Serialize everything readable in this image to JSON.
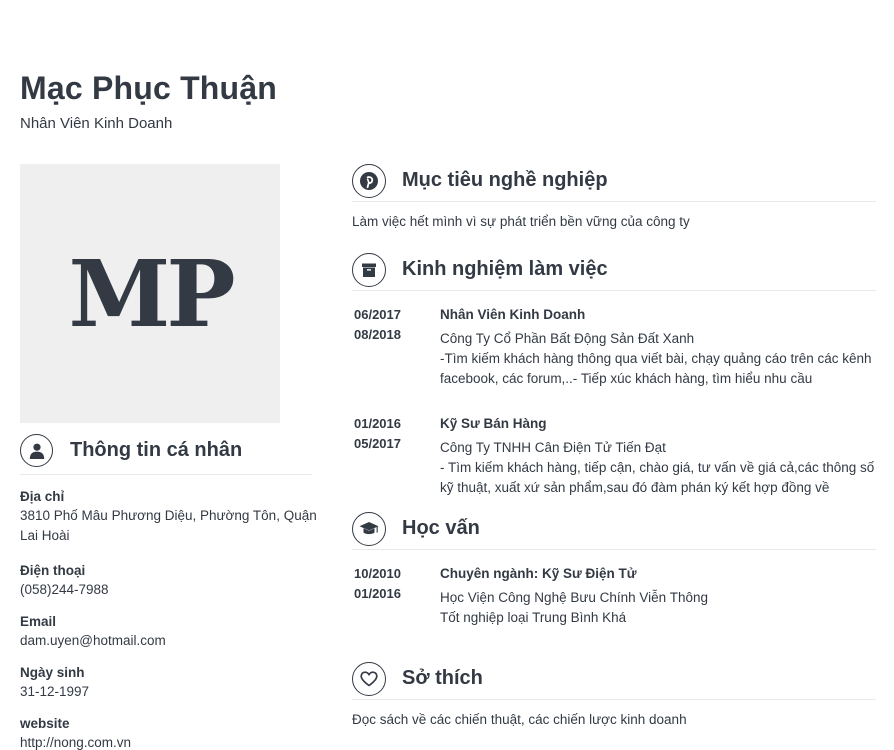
{
  "profile": {
    "name": "Mạc Phục Thuận",
    "title": "Nhân Viên Kinh Doanh",
    "initials": "MP"
  },
  "personal": {
    "heading": "Thông tin cá nhân",
    "items": [
      {
        "label": "Địa chỉ",
        "value": "3810 Phố Mâu Phương Diệu, Phường Tôn, Quận Lai Hoài"
      },
      {
        "label": "Điện thoại",
        "value": "(058)244-7988"
      },
      {
        "label": "Email",
        "value": "dam.uyen@hotmail.com"
      },
      {
        "label": "Ngày sinh",
        "value": "31-12-1997"
      },
      {
        "label": "website",
        "value": "http://nong.com.vn"
      }
    ]
  },
  "objective": {
    "heading": "Mục tiêu nghề nghiệp",
    "text": "Làm việc hết mình vì sự phát triển bền vững của công ty"
  },
  "experience": {
    "heading": "Kinh nghiệm làm việc",
    "entries": [
      {
        "start": "06/2017",
        "end": "08/2018",
        "position": "Nhân Viên Kinh Doanh",
        "company": "Công Ty Cổ Phần Bất Động Sản Đất Xanh",
        "description": "-Tìm kiếm khách hàng thông qua viết bài, chạy quảng cáo trên các kênh facebook, các forum,..- Tiếp xúc khách hàng, tìm hiểu nhu cầu"
      },
      {
        "start": "01/2016",
        "end": "05/2017",
        "position": "Kỹ Sư Bán Hàng",
        "company": "Công Ty TNHH Cân Điện Tử Tiến Đạt",
        "description": "- Tìm kiếm khách hàng, tiếp cận, chào giá, tư vấn về giá cả,các thông số kỹ thuật, xuất xứ sản phẩm,sau đó đàm phán ký kết hợp đồng về"
      }
    ]
  },
  "education": {
    "heading": "Học vấn",
    "entries": [
      {
        "start": "10/2010",
        "end": "01/2016",
        "major": "Chuyên ngành: Kỹ Sư Điện Tử",
        "school": "Học Viện Công Nghệ Bưu Chính Viễn Thông",
        "grade": "Tốt nghiệp loại Trung Bình Khá"
      }
    ]
  },
  "hobbies": {
    "heading": "Sở thích",
    "text": "Đọc sách về các chiến thuật, các chiến lược kinh doanh"
  },
  "icons": {
    "personal": "user-icon",
    "objective": "pinterest-icon",
    "experience": "archive-box-icon",
    "education": "graduation-cap-icon",
    "hobbies": "heart-icon"
  }
}
